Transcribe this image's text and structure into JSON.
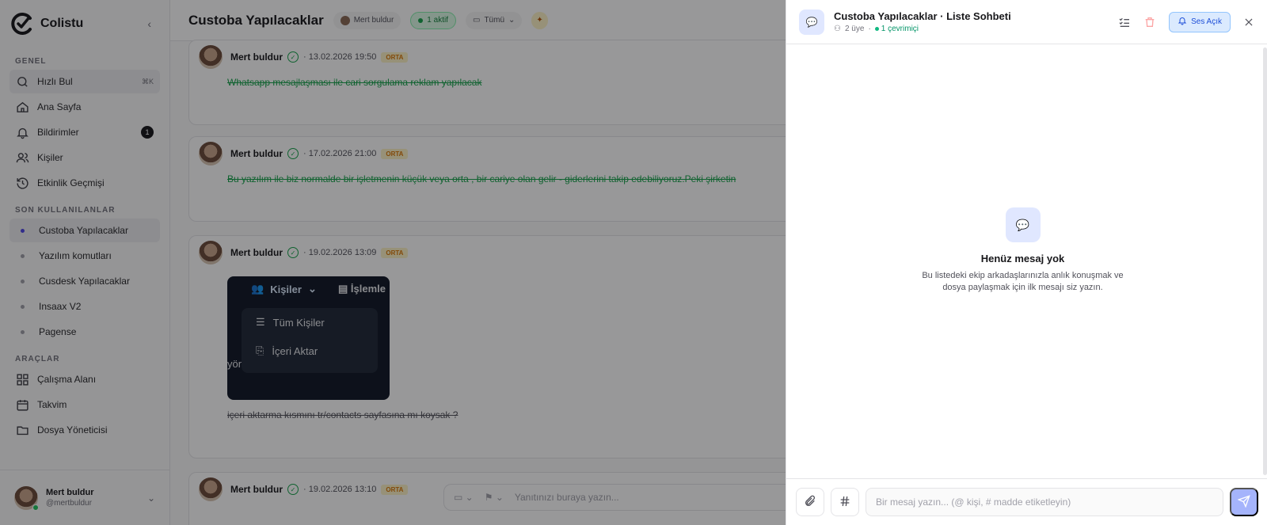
{
  "sidebar": {
    "brand": "Colistu",
    "sections": {
      "genel": "GENEL",
      "son": "SON KULLANILANLAR",
      "araclar": "ARAÇLAR"
    },
    "genel_items": [
      {
        "label": "Hızlı Bul",
        "kbd": "⌘K",
        "icon": "search-icon"
      },
      {
        "label": "Ana Sayfa",
        "icon": "home-icon"
      },
      {
        "label": "Bildirimler",
        "count": "1",
        "icon": "bell-icon"
      },
      {
        "label": "Kişiler",
        "icon": "users-icon"
      },
      {
        "label": "Etkinlik Geçmişi",
        "icon": "history-icon"
      }
    ],
    "recent_items": [
      {
        "label": "Custoba Yapılacaklar"
      },
      {
        "label": "Yazılım komutları"
      },
      {
        "label": "Cusdesk Yapılacaklar"
      },
      {
        "label": "Insaax V2"
      },
      {
        "label": "Pagense"
      }
    ],
    "tool_items": [
      {
        "label": "Çalışma Alanı",
        "icon": "grid-icon"
      },
      {
        "label": "Takvim",
        "icon": "calendar-icon"
      },
      {
        "label": "Dosya Yöneticisi",
        "icon": "folder-icon"
      }
    ],
    "user": {
      "name": "Mert buldur",
      "handle": "@mertbuldur"
    }
  },
  "main": {
    "title": "Custoba Yapılacaklar",
    "owner_chip": "Mert buldur",
    "active_chip": "1 aktif",
    "filter_chip": "Tümü",
    "messages": [
      {
        "author": "Mert buldur",
        "time": "· 13.02.2026 19:50",
        "priority": "ORTA",
        "text": "Whatsapp mesajlaşması ile cari sorgulama reklam yapılacak"
      },
      {
        "author": "Mert buldur",
        "time": "· 17.02.2026 21:00",
        "priority": "ORTA",
        "text": "Bu yazılım ile biz normalde bir işletmenin küçük veya orta , bir cariye olan gelir - giderlerini takip edebiliyoruz.Peki şirketin"
      },
      {
        "author": "Mert buldur",
        "time": "· 19.02.2026 13:09",
        "priority": "ORTA",
        "text": "içeri aktarma kısmını tr/contacts sayfasına mı koysak ?"
      },
      {
        "author": "Mert buldur",
        "time": "· 19.02.2026 13:10",
        "priority": "ORTA"
      }
    ],
    "embed": {
      "tab1": "Kişiler",
      "tab2": "İşlemle",
      "item1": "Tüm Kişiler",
      "item2": "İçeri Aktar",
      "stub": "yön"
    },
    "reply_placeholder": "Yanıtınızı buraya yazın..."
  },
  "panel": {
    "title": "Custoba Yapılacaklar · Liste Sohbeti",
    "members": "2 üye",
    "online": "1 çevrimiçi",
    "sound_button": "Ses Açık",
    "empty_title": "Henüz mesaj yok",
    "empty_desc_1": "Bu listedeki ekip arkadaşlarınızla anlık konuşmak ve",
    "empty_desc_2": "dosya paylaşmak için ilk mesajı siz yazın.",
    "input_placeholder": "Bir mesaj yazın... (@ kişi, # madde etiketleyin)"
  }
}
